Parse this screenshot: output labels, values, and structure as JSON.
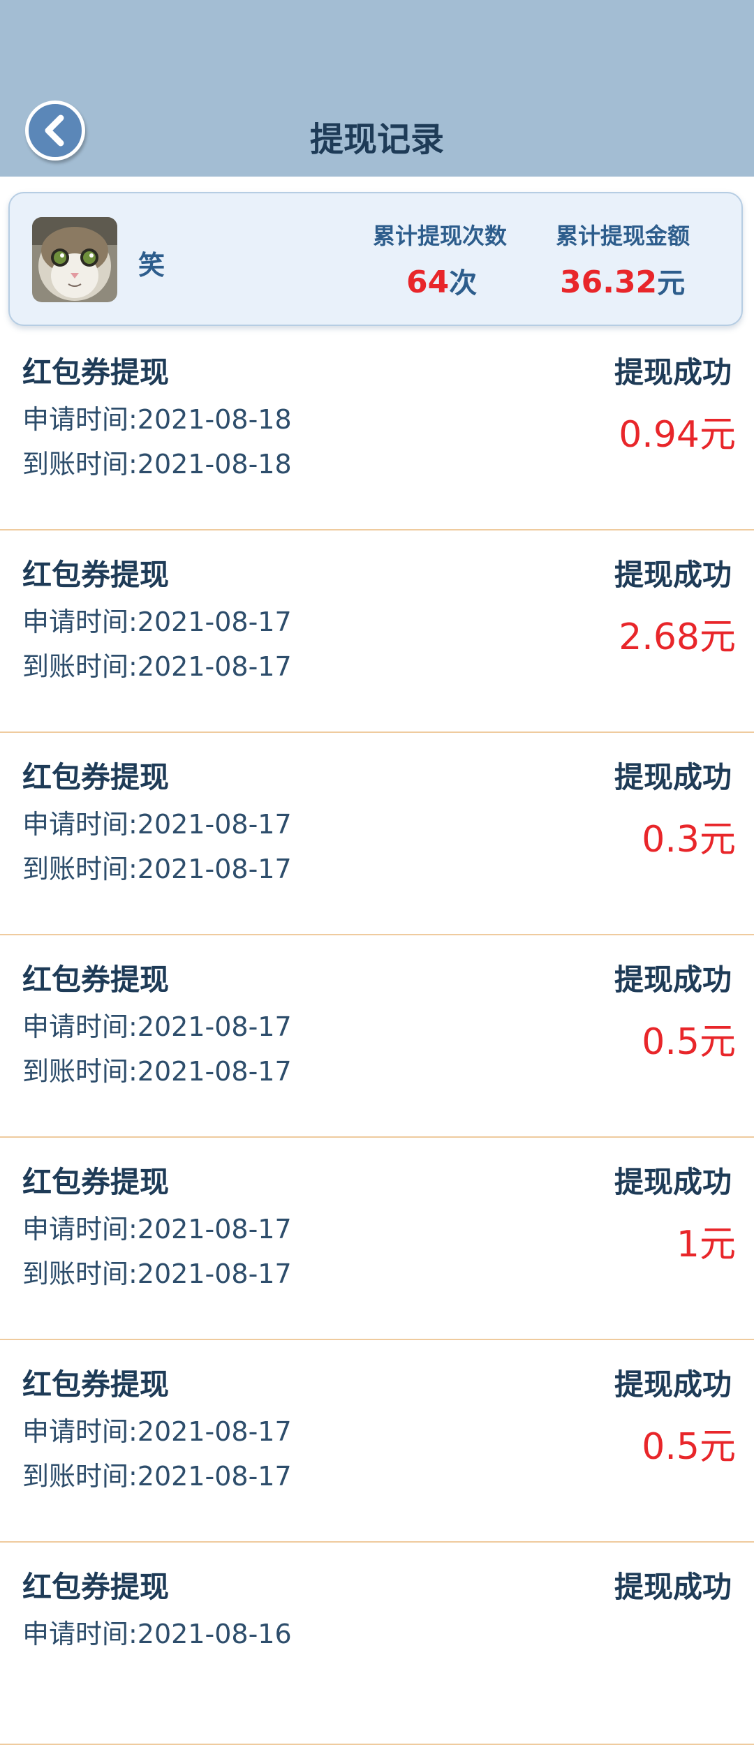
{
  "header": {
    "title": "提现记录",
    "back_icon": "chevron-left-icon"
  },
  "summary": {
    "username": "笑",
    "count_label": "累计提现次数",
    "count_value": "64",
    "count_unit": "次",
    "amount_label": "累计提现金额",
    "amount_value": "36.32",
    "amount_unit": "元"
  },
  "records": [
    {
      "type": "红包券提现",
      "apply": "申请时间:2021-08-18",
      "arrive": "到账时间:2021-08-18",
      "status": "提现成功",
      "amount": "0.94元"
    },
    {
      "type": "红包券提现",
      "apply": "申请时间:2021-08-17",
      "arrive": "到账时间:2021-08-17",
      "status": "提现成功",
      "amount": "2.68元"
    },
    {
      "type": "红包券提现",
      "apply": "申请时间:2021-08-17",
      "arrive": "到账时间:2021-08-17",
      "status": "提现成功",
      "amount": "0.3元"
    },
    {
      "type": "红包券提现",
      "apply": "申请时间:2021-08-17",
      "arrive": "到账时间:2021-08-17",
      "status": "提现成功",
      "amount": "0.5元"
    },
    {
      "type": "红包券提现",
      "apply": "申请时间:2021-08-17",
      "arrive": "到账时间:2021-08-17",
      "status": "提现成功",
      "amount": "1元"
    },
    {
      "type": "红包券提现",
      "apply": "申请时间:2021-08-17",
      "arrive": "到账时间:2021-08-17",
      "status": "提现成功",
      "amount": "0.5元"
    },
    {
      "type": "红包券提现",
      "apply": "申请时间:2021-08-16",
      "arrive": "",
      "status": "提现成功",
      "amount": ""
    }
  ],
  "colors": {
    "header_bg": "#a3bdd3",
    "title": "#1e3b57",
    "accent_blue": "#2d5d8c",
    "amount_red": "#e8262a",
    "divider": "#efcb9e"
  }
}
